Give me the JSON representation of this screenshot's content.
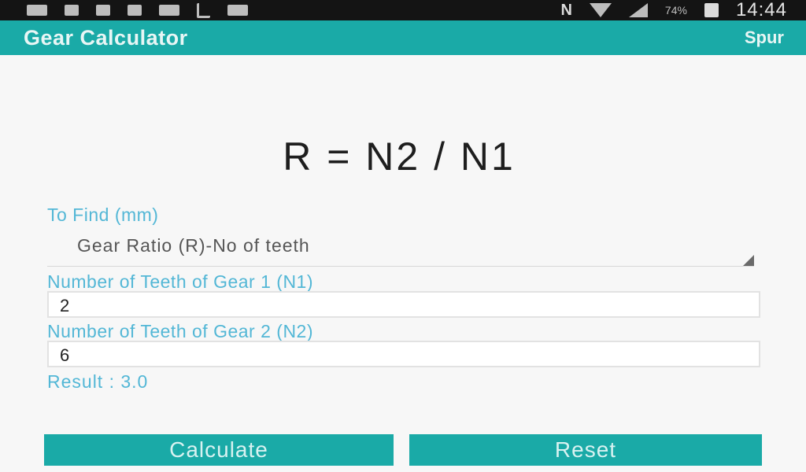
{
  "status_bar": {
    "battery_percent": "74%",
    "time": "14:44",
    "icons": [
      "back-icon",
      "app-icon",
      "facebook-icon",
      "facebook-icon",
      "mail-icon",
      "usb-icon",
      "image-icon",
      "nfc-icon",
      "wifi-icon",
      "signal-icon",
      "battery-icon"
    ]
  },
  "app_bar": {
    "title": "Gear Calculator",
    "action": "Spur"
  },
  "formula": "R = N2 / N1",
  "to_find": {
    "label": "To Find (mm)",
    "selected": "Gear Ratio (R)-No of teeth"
  },
  "gear1": {
    "label": "Number of Teeth of Gear 1 (N1)",
    "value": "2"
  },
  "gear2": {
    "label": "Number of Teeth of Gear 2 (N2)",
    "value": "6"
  },
  "result": "Result : 3.0",
  "buttons": {
    "calculate": "Calculate",
    "reset": "Reset"
  },
  "colors": {
    "accent": "#1aaaa7",
    "label": "#53b7d6"
  }
}
